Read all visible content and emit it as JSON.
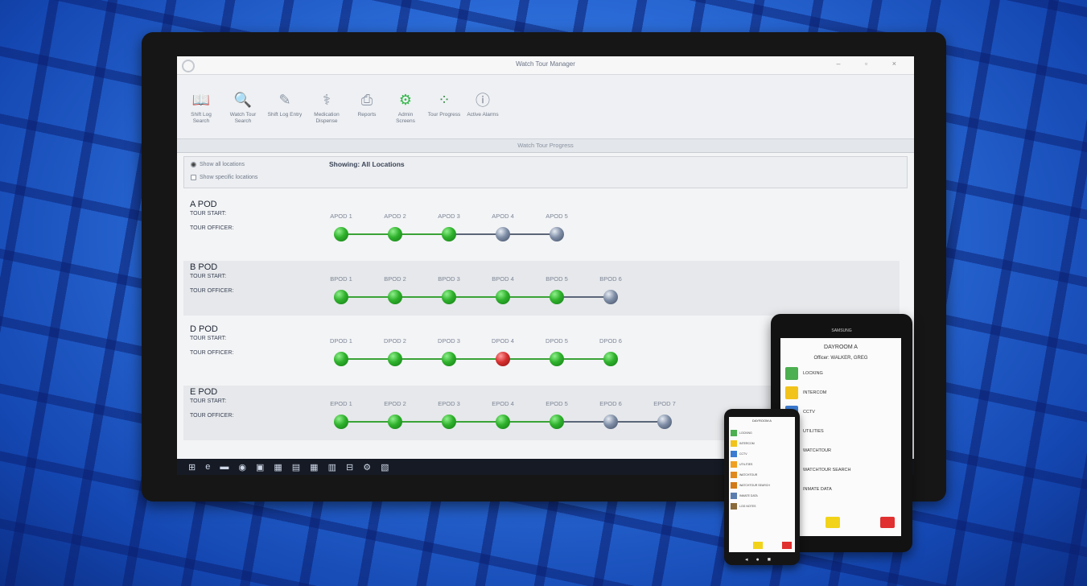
{
  "window": {
    "title": "Watch Tour Manager",
    "controls": "– ▫ ×"
  },
  "ribbon": [
    {
      "label": "Shift Log Search",
      "icon": "book-icon"
    },
    {
      "label": "Watch Tour Search",
      "icon": "search-icon"
    },
    {
      "label": "Shift Log Entry",
      "icon": "pen-icon"
    },
    {
      "label": "Medication Dispense",
      "icon": "medication-icon"
    },
    {
      "label": "Reports",
      "icon": "printer-icon"
    },
    {
      "label": "Admin Screens",
      "icon": "admin-icon"
    },
    {
      "label": "Tour Progress",
      "icon": "dots-grid-icon"
    },
    {
      "label": "Active Alarms",
      "icon": "alert-icon"
    }
  ],
  "section": {
    "title": "Watch Tour Progress"
  },
  "filter": {
    "option_all": "Show all locations",
    "option_specific": "Show specific locations",
    "showing": "Showing: All Locations"
  },
  "labels": {
    "tour_start": "TOUR START:",
    "tour_officer": "TOUR OFFICER:"
  },
  "pods": [
    {
      "name": "A POD",
      "checkpoints": [
        "APOD 1",
        "APOD 2",
        "APOD 3",
        "APOD 4",
        "APOD 5"
      ],
      "status": [
        "done",
        "done",
        "done",
        "pending",
        "pending"
      ]
    },
    {
      "name": "B POD",
      "checkpoints": [
        "BPOD 1",
        "BPOD 2",
        "BPOD 3",
        "BPOD 4",
        "BPOD 5",
        "BPOD 6"
      ],
      "status": [
        "done",
        "done",
        "done",
        "done",
        "done",
        "pending"
      ]
    },
    {
      "name": "D POD",
      "checkpoints": [
        "DPOD 1",
        "DPOD 2",
        "DPOD 3",
        "DPOD 4",
        "DPOD 5",
        "DPOD 6"
      ],
      "status": [
        "done",
        "done",
        "done",
        "missed",
        "done",
        "done"
      ]
    },
    {
      "name": "E POD",
      "checkpoints": [
        "EPOD 1",
        "EPOD 2",
        "EPOD 3",
        "EPOD 4",
        "EPOD 5",
        "EPOD 6",
        "EPOD 7"
      ],
      "status": [
        "done",
        "done",
        "done",
        "done",
        "done",
        "pending",
        "pending"
      ]
    }
  ],
  "colors": {
    "done": "#2fb12c",
    "pending": "#7f8ea6",
    "missed": "#d62f2f",
    "line_done": "#3aa336",
    "line_pending": "#5b6678"
  },
  "tablet": {
    "brand": "SAMSUNG",
    "header": "DAYROOM A",
    "officer": "Officer: WALKER, GREG",
    "items": [
      {
        "label": "LOCKING",
        "color": "#4caf50"
      },
      {
        "label": "INTERCOM",
        "color": "#f2c31a"
      },
      {
        "label": "CCTV",
        "color": "#3b7bd1"
      },
      {
        "label": "UTILITIES",
        "color": "#e0e0e0"
      },
      {
        "label": "WATCHTOUR",
        "color": "#e0e0e0"
      },
      {
        "label": "WATCHTOUR SEARCH",
        "color": "#e0e0e0"
      },
      {
        "label": "INMATE DATA",
        "color": "#e0e0e0"
      }
    ]
  },
  "phone": {
    "header": "DAYROOM A",
    "items": [
      {
        "label": "LOCKING",
        "color": "#4caf50"
      },
      {
        "label": "INTERCOM",
        "color": "#f2c31a"
      },
      {
        "label": "CCTV",
        "color": "#3b7bd1"
      },
      {
        "label": "UTILITIES",
        "color": "#f0a020"
      },
      {
        "label": "WATCHTOUR",
        "color": "#e08a1e"
      },
      {
        "label": "WATCHTOUR SEARCH",
        "color": "#d27a18"
      },
      {
        "label": "INMATE DATA",
        "color": "#5a7db0"
      },
      {
        "label": "LOG NOTES",
        "color": "#8a6a3a"
      }
    ]
  }
}
